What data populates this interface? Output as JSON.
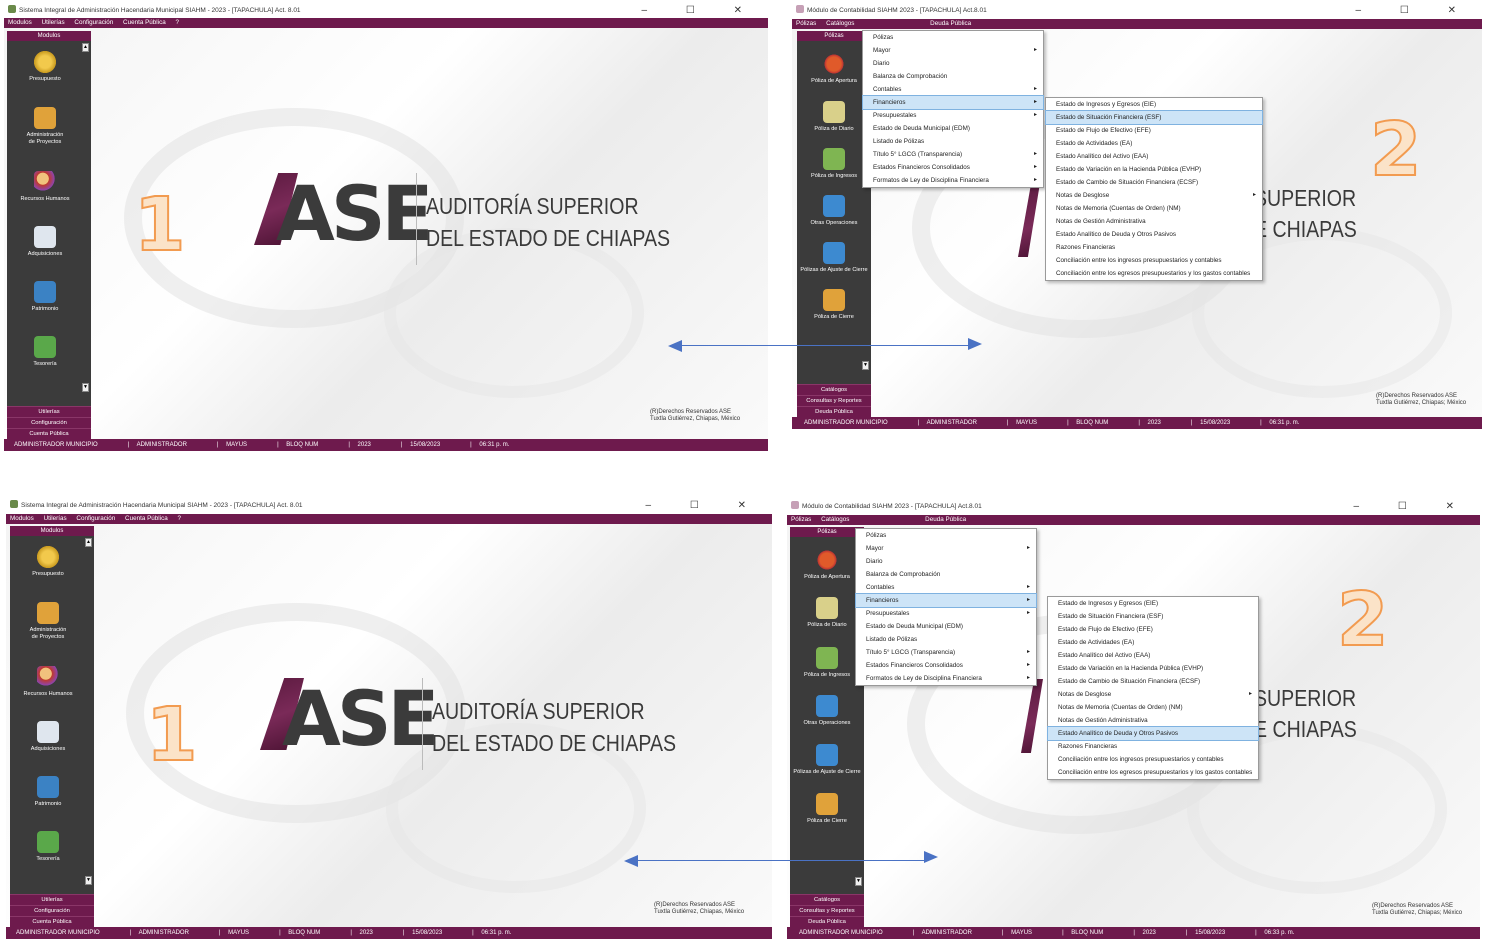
{
  "siahm": {
    "title": "Sistema Integral de Administración Hacendaria Municipal SIAHM - 2023 - [TAPACHULA]  Act. 8.01",
    "menu": [
      "Modulos",
      "Utilerías",
      "Configuración",
      "Cuenta Pública",
      "?"
    ],
    "sidebar_header": "Modulos",
    "modules": [
      "Presupuesto",
      "Administración",
      "de Proyectos",
      "Recursos Humanos",
      "Adquisiciones",
      "Patrimonio",
      "Tesorería"
    ],
    "footer": [
      "Utilerías",
      "Configuración",
      "Cuenta Pública"
    ]
  },
  "contab": {
    "title": "Módulo de Contabilidad SIAHM 2023 - [TAPACHULA] Act.8.01",
    "menu": [
      "Pólizas",
      "Catálogos",
      "Deuda Pública"
    ],
    "sidebar_header": "Pólizas",
    "modules": [
      "Póliza de Apertura",
      "Póliza de Diario",
      "Póliza de Ingresos",
      "Otras Operaciones",
      "Pólizas de Ajuste de Cierre",
      "Póliza de Cierre"
    ],
    "footer": [
      "Catálogos",
      "Consultas y Reportes",
      "Deuda Pública"
    ]
  },
  "logo": {
    "letters": "ASE",
    "line1": "AUDITORÍA SUPERIOR",
    "line2": "DEL ESTADO DE CHIAPAS",
    "partial1": "SUPERIOR",
    "partial2": "E CHIAPAS"
  },
  "copyright": {
    "line1": "(R)Derechos Reservados ASE",
    "line2a": "Tuxtla Gutiérrez, Chiapas, México",
    "line2b": "Tuxtla Gutiérrez, Chiapas; México"
  },
  "status": {
    "user": "ADMINISTRADOR MUNICIPIO",
    "role": "ADMINISTRADOR",
    "mayus": "MAYUS",
    "bloq": "BLOQ NUM",
    "year": "2023",
    "date": "15/08/2023",
    "time1": "06:31 p. m.",
    "time2": "06:33 p. m."
  },
  "reportes_menu": [
    "Pólizas",
    "Mayor",
    "Diario",
    "Balanza de Comprobación",
    "Contables",
    "Financieros",
    "Presupuestales",
    "Estado de Deuda Municipal (EDM)",
    "Listado de Pólizas",
    "Título 5° LGCG (Transparencia)",
    "Estados Financieros Consolidados",
    "Formatos de Ley de Disciplina Financiera"
  ],
  "financieros_submenu": [
    "Estado de Ingresos y Egresos (EIE)",
    "Estado de Situación Financiera (ESF)",
    "Estado de Flujo de Efectivo (EFE)",
    "Estado de Actividades (EA)",
    "Estado Analítico del Activo (EAA)",
    "Estado de Variación en la Hacienda Pública (EVHP)",
    "Estado de Cambio de Situación Financiera (ECSF)",
    "Notas de Desglose",
    "Notas de Memoria (Cuentas de Orden) (NM)",
    "Notas de Gestión Administrativa",
    "Estado Analítico de Deuda y Otros Pasivos",
    "Razones Financieras",
    "Conciliación entre los ingresos presupuestarios y contables",
    "Conciliación entre los egresos presupuestarios y los gastos contables"
  ],
  "labels": {
    "one": "1",
    "two": "2"
  },
  "window_controls": "–  ☐  ✕"
}
